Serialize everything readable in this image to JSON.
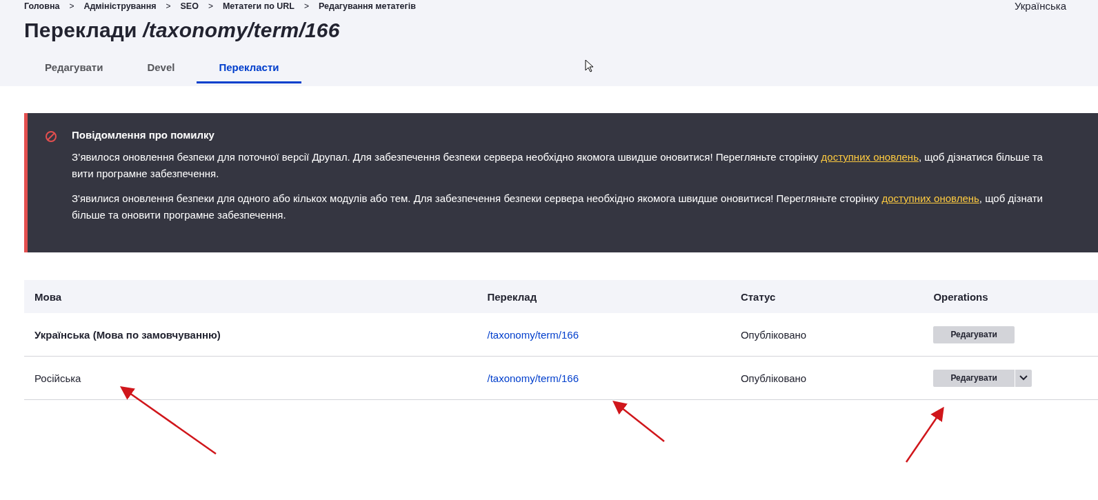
{
  "breadcrumb": [
    "Головна",
    "Адміністрування",
    "SEO",
    "Метатеги по URL",
    "Редагування метатегів"
  ],
  "breadcrumb_separator": ">",
  "language_switcher": "Українська",
  "title": {
    "prefix": "Переклади",
    "path": "/taxonomy/term/166"
  },
  "tabs": [
    {
      "label": "Редагувати",
      "selected": false
    },
    {
      "label": "Devel",
      "selected": false
    },
    {
      "label": "Перекласти",
      "selected": true
    }
  ],
  "message": {
    "kind": "error",
    "title": "Повідомлення про помилку",
    "paragraphs": [
      {
        "before": "З’явилося оновлення безпеки для поточної версії Друпал. Для забезпечення безпеки сервера необхідно якомога швидше оновитися! Перегляньте сторінку ",
        "link": "доступних оновлень",
        "after": ", щоб дізнатися більше та",
        "continuation": "вити програмне забезпечення."
      },
      {
        "before": "З'явилися оновлення безпеки для одного або кількох модулів або тем. Для забезпечення безпеки сервера необхідно якомога швидше оновитися! Перегляньте сторінку ",
        "link": "доступних оновлень",
        "after": ", щоб дізнати",
        "continuation": "більше та оновити програмне забезпечення."
      }
    ]
  },
  "table": {
    "columns": [
      "Мова",
      "Переклад",
      "Статус",
      "Operations"
    ],
    "rows": [
      {
        "language": "Українська (Мова по замовчуванню)",
        "default": true,
        "translation": "/taxonomy/term/166",
        "status": "Опубліковано",
        "operation": "Редагувати",
        "has_dropdown": false
      },
      {
        "language": "Російська",
        "default": false,
        "translation": "/taxonomy/term/166",
        "status": "Опубліковано",
        "operation": "Редагувати",
        "has_dropdown": true
      }
    ]
  }
}
